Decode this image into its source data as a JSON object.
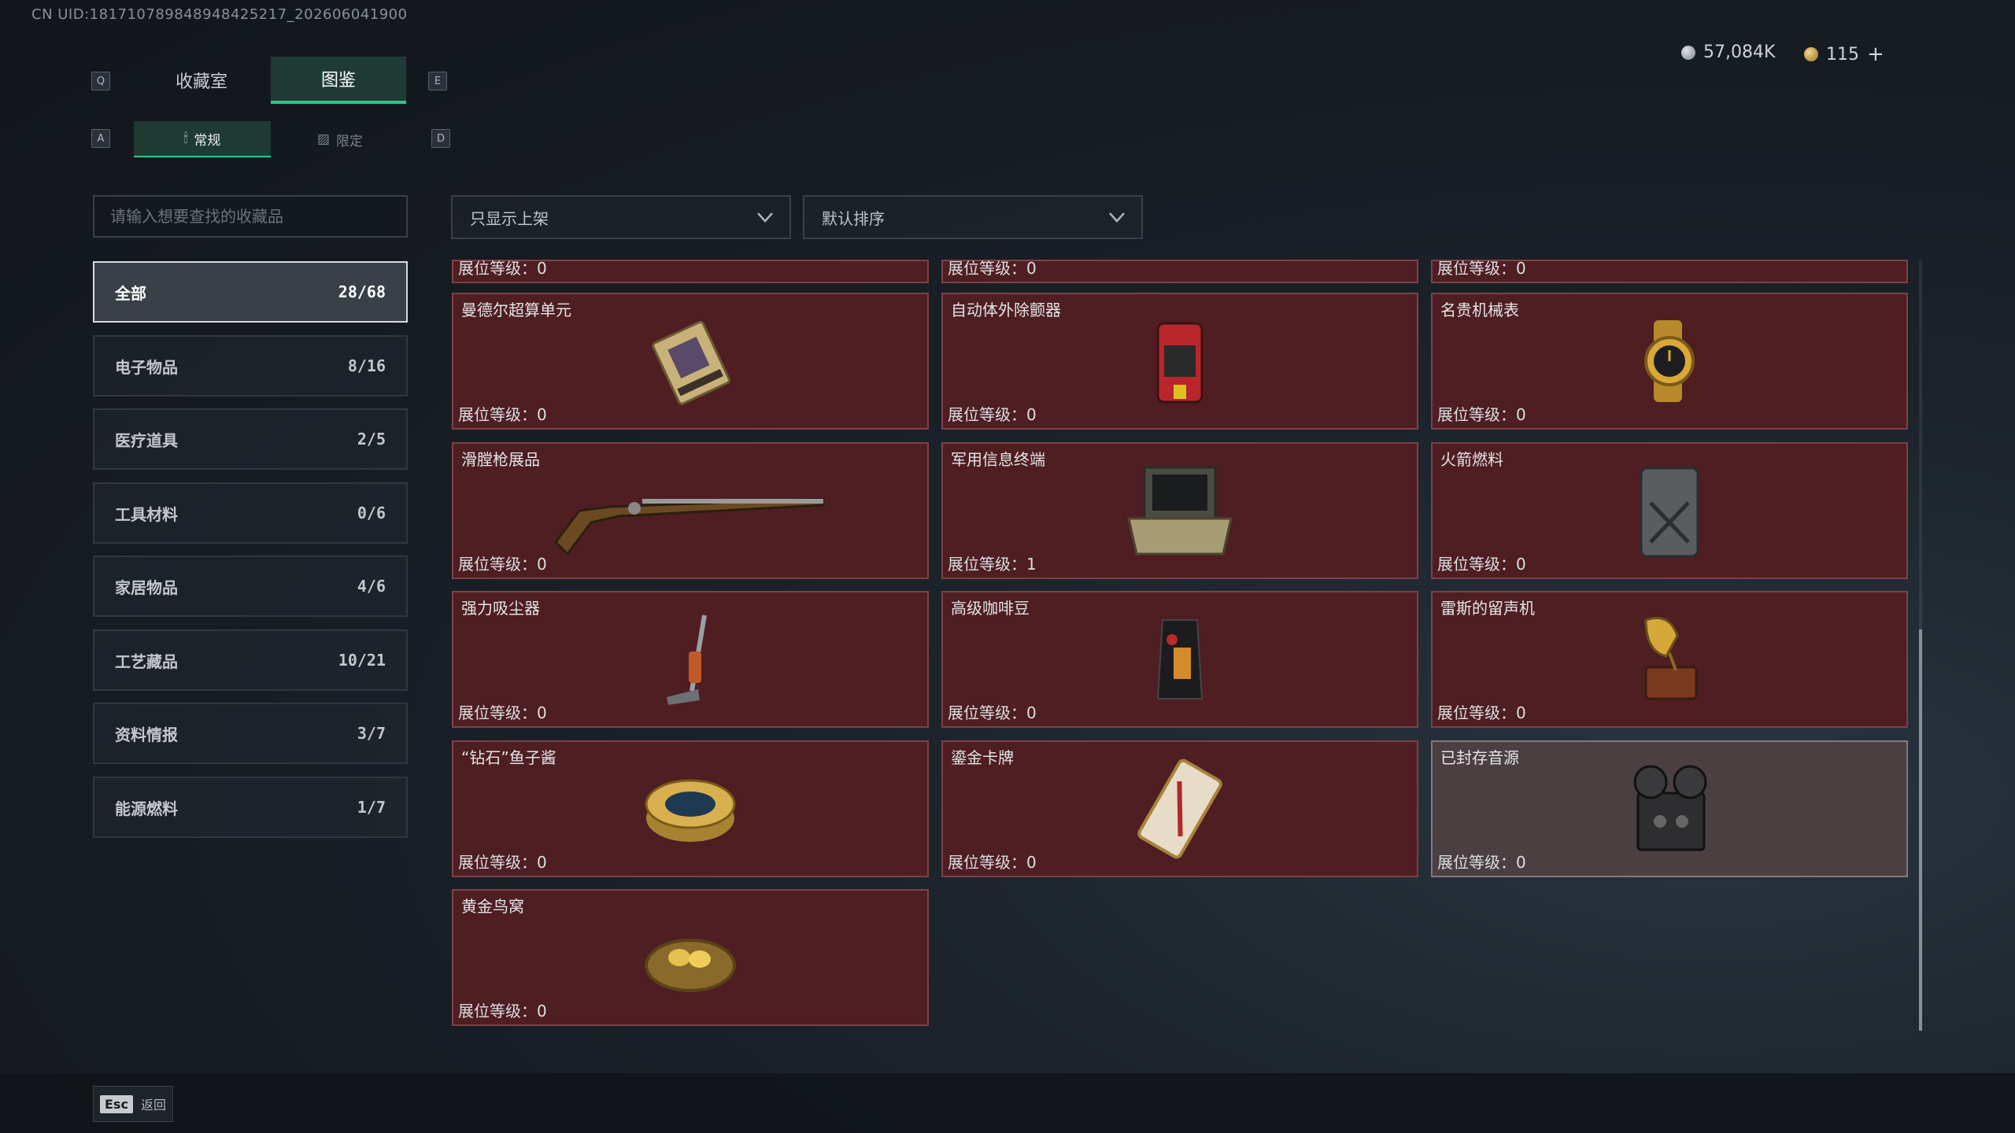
{
  "uid_text": "CN UID:181710789848948425217_202606041900",
  "currency": {
    "silver": "57,084K",
    "gold": "115",
    "gold_plus": "+"
  },
  "keys": {
    "q": "Q",
    "e": "E",
    "a": "A",
    "d": "D"
  },
  "tabs": [
    {
      "label": "收藏室",
      "active": false
    },
    {
      "label": "图鉴",
      "active": true
    }
  ],
  "subtabs": [
    {
      "label": "常规",
      "active": true
    },
    {
      "label": "限定",
      "active": false
    }
  ],
  "search": {
    "placeholder": "请输入想要查找的收藏品"
  },
  "filters": {
    "shelf": "只显示上架",
    "sort": "默认排序"
  },
  "categories": [
    {
      "label": "全部",
      "count": "28/68",
      "active": true
    },
    {
      "label": "电子物品",
      "count": "8/16"
    },
    {
      "label": "医疗道具",
      "count": "2/5"
    },
    {
      "label": "工具材料",
      "count": "0/6"
    },
    {
      "label": "家居物品",
      "count": "4/6"
    },
    {
      "label": "工艺藏品",
      "count": "10/21"
    },
    {
      "label": "资料情报",
      "count": "3/7"
    },
    {
      "label": "能源燃料",
      "count": "1/7"
    }
  ],
  "level_prefix": "展位等级：",
  "partial_row": [
    {
      "level": "0"
    },
    {
      "level": "0"
    },
    {
      "level": "0"
    }
  ],
  "items": [
    {
      "name": "曼德尔超算单元",
      "level": "0",
      "icon": "supercomputer-unit-icon"
    },
    {
      "name": "自动体外除颤器",
      "level": "0",
      "icon": "defibrillator-icon"
    },
    {
      "name": "名贵机械表",
      "level": "0",
      "icon": "gold-watch-icon"
    },
    {
      "name": "滑膛枪展品",
      "level": "0",
      "icon": "musket-icon"
    },
    {
      "name": "军用信息终端",
      "level": "1",
      "icon": "military-terminal-icon"
    },
    {
      "name": "火箭燃料",
      "level": "0",
      "icon": "fuel-canister-icon"
    },
    {
      "name": "强力吸尘器",
      "level": "0",
      "icon": "vacuum-cleaner-icon"
    },
    {
      "name": "高级咖啡豆",
      "level": "0",
      "icon": "coffee-bag-icon"
    },
    {
      "name": "雷斯的留声机",
      "level": "0",
      "icon": "gramophone-icon"
    },
    {
      "name": "“钻石”鱼子酱",
      "level": "0",
      "icon": "caviar-tin-icon"
    },
    {
      "name": "鎏金卡牌",
      "level": "0",
      "icon": "gilded-card-icon"
    },
    {
      "name": "已封存音源",
      "level": "0",
      "icon": "reel-recorder-icon",
      "grey": true
    },
    {
      "name": "黄金鸟窝",
      "level": "0",
      "icon": "golden-nest-icon"
    }
  ],
  "esc": {
    "key": "Esc",
    "label": "返回"
  }
}
